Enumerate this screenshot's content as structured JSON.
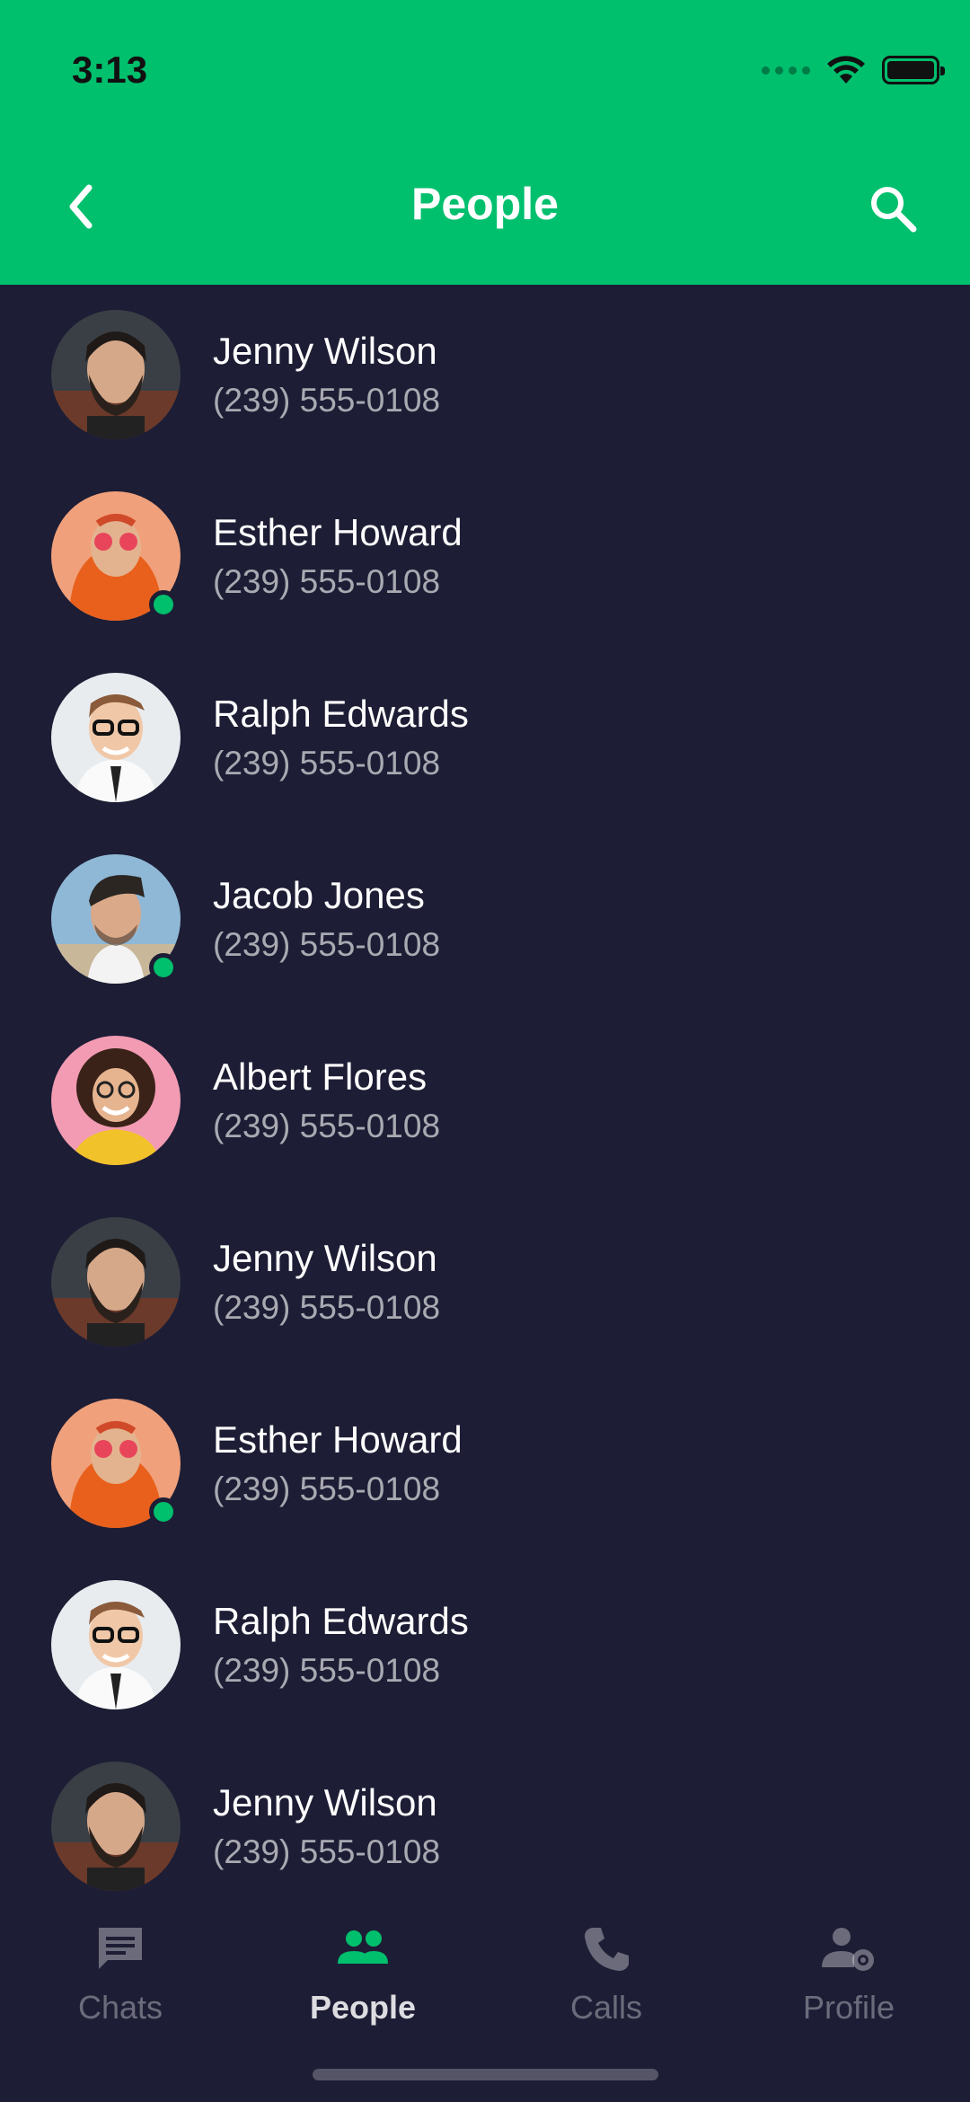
{
  "status_bar": {
    "time": "3:13"
  },
  "header": {
    "title": "People",
    "back_icon": "chevron-left-icon",
    "search_icon": "search-icon"
  },
  "contacts": [
    {
      "name": "Jenny Wilson",
      "phone": "(239) 555-0108",
      "online": false,
      "avatar": "bearded-man"
    },
    {
      "name": "Esther Howard",
      "phone": "(239) 555-0108",
      "online": true,
      "avatar": "man-orange-hoodie"
    },
    {
      "name": "Ralph Edwards",
      "phone": "(239) 555-0108",
      "online": false,
      "avatar": "man-glasses-suit"
    },
    {
      "name": "Jacob Jones",
      "phone": "(239) 555-0108",
      "online": true,
      "avatar": "man-quiff"
    },
    {
      "name": "Albert Flores",
      "phone": "(239) 555-0108",
      "online": false,
      "avatar": "woman-curly-hair"
    },
    {
      "name": "Jenny Wilson",
      "phone": "(239) 555-0108",
      "online": false,
      "avatar": "bearded-man"
    },
    {
      "name": "Esther Howard",
      "phone": "(239) 555-0108",
      "online": true,
      "avatar": "man-orange-hoodie"
    },
    {
      "name": "Ralph Edwards",
      "phone": "(239) 555-0108",
      "online": false,
      "avatar": "man-glasses-suit"
    },
    {
      "name": "Jenny Wilson",
      "phone": "(239) 555-0108",
      "online": false,
      "avatar": "bearded-man"
    }
  ],
  "tabs": [
    {
      "label": "Chats",
      "icon": "chat-icon",
      "active": false
    },
    {
      "label": "People",
      "icon": "people-icon",
      "active": true
    },
    {
      "label": "Calls",
      "icon": "phone-icon",
      "active": false
    },
    {
      "label": "Profile",
      "icon": "profile-settings-icon",
      "active": false
    }
  ],
  "colors": {
    "accent": "#00bf6d",
    "background": "#1d1d35"
  }
}
